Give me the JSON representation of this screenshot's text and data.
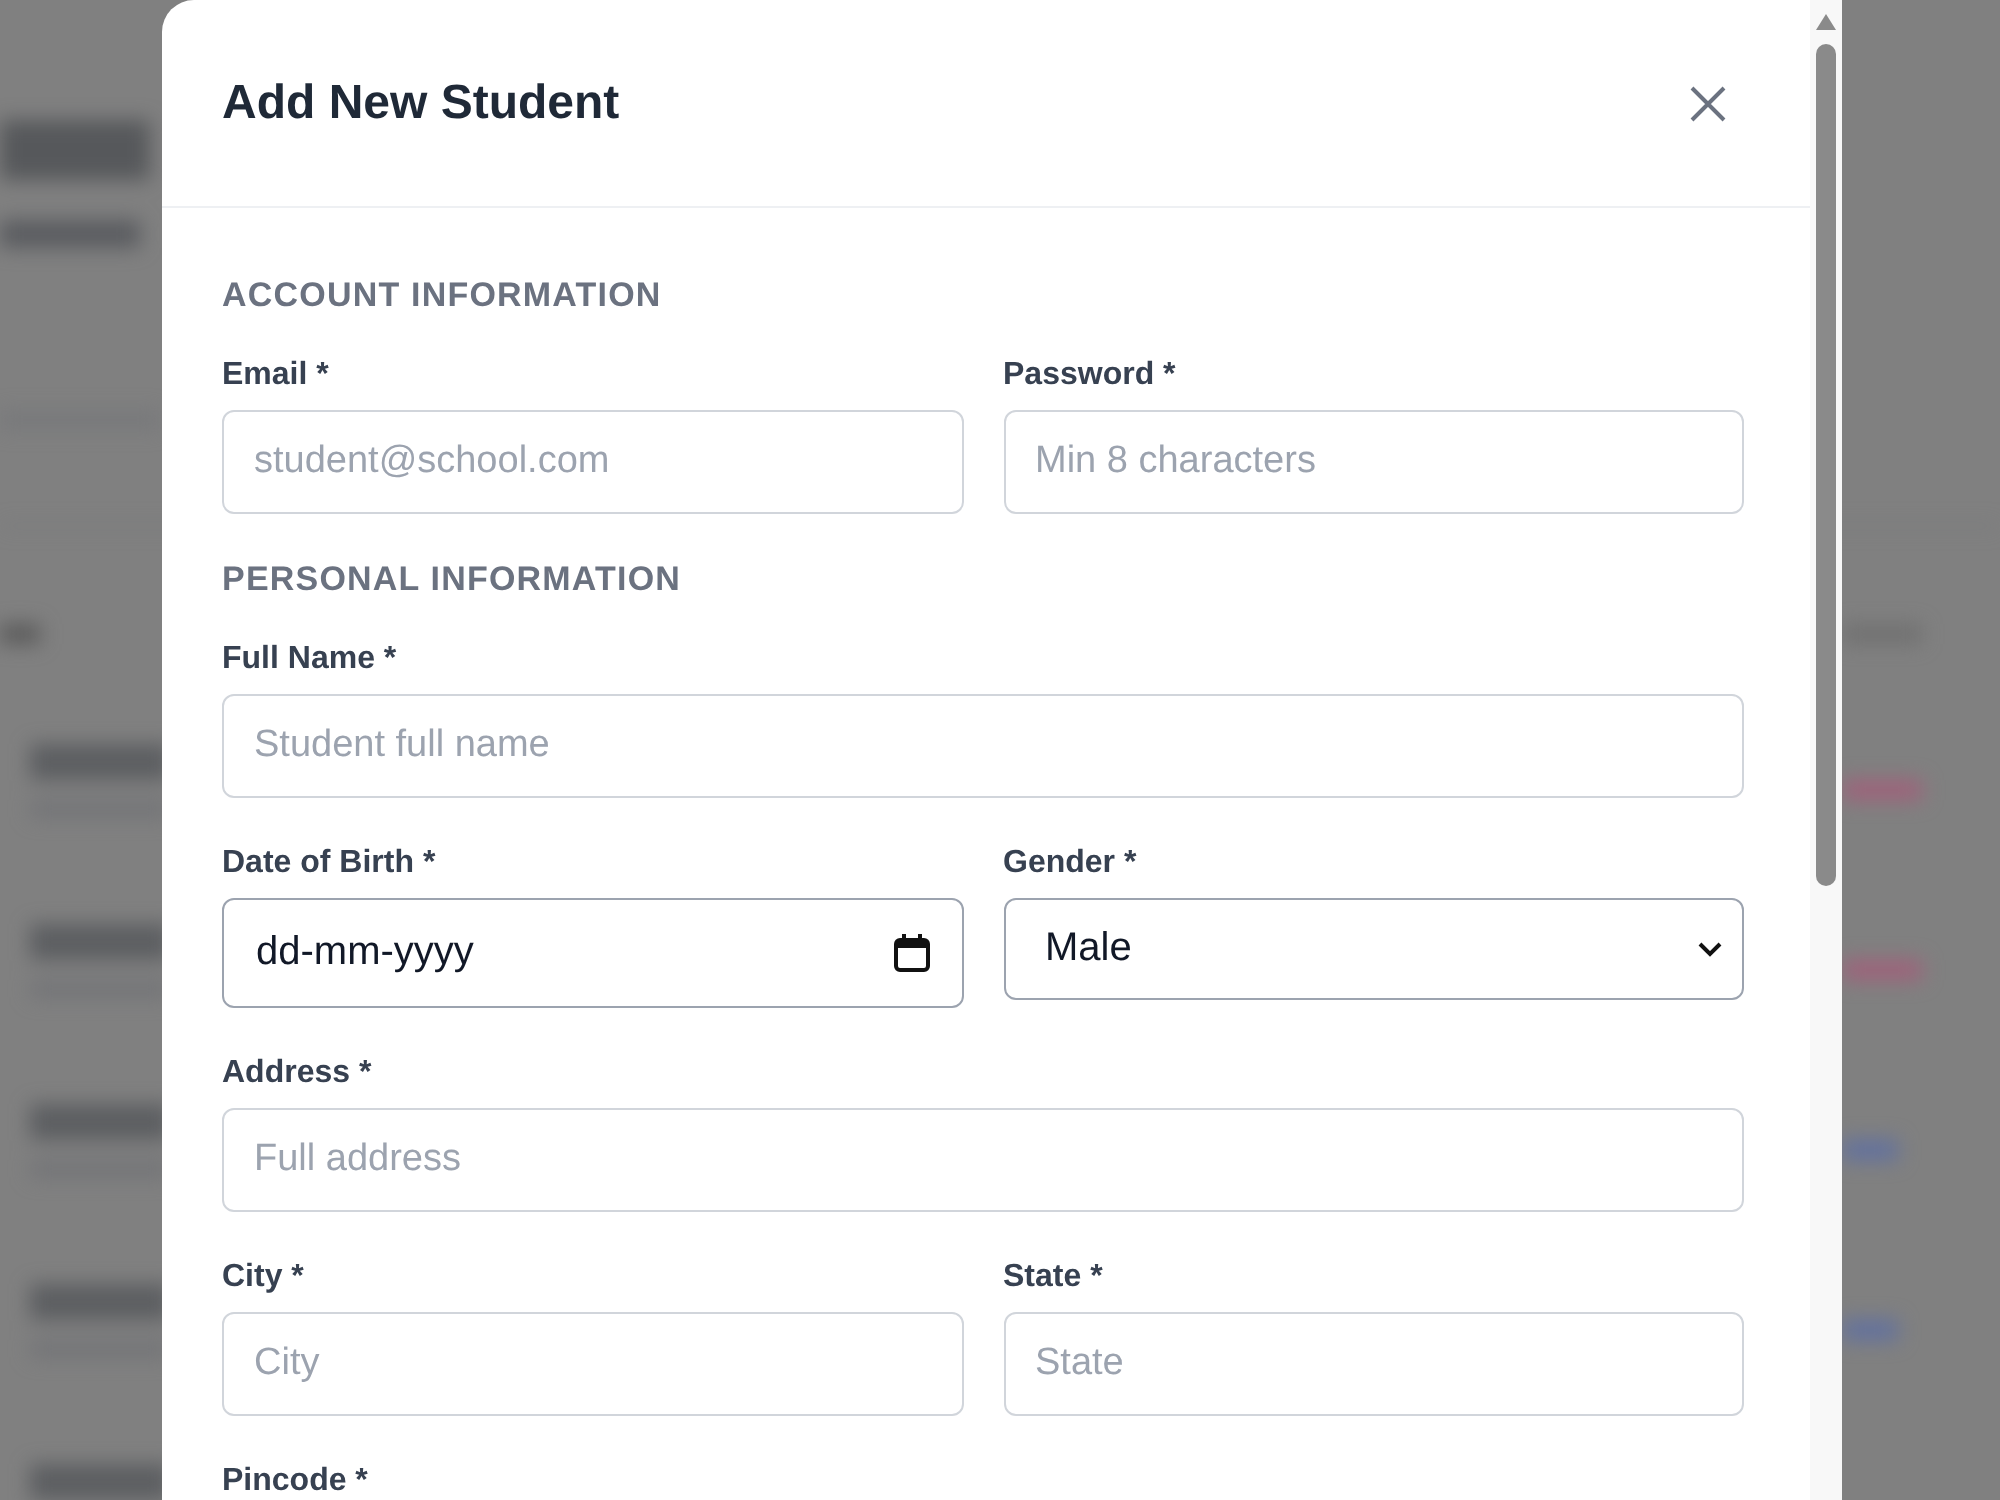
{
  "dialog": {
    "title": "Add New Student",
    "sections": [
      {
        "title": "ACCOUNT INFORMATION",
        "rows": [
          [
            {
              "label": "Email *",
              "kind": "text",
              "placeholder": "student@school.com"
            },
            {
              "label": "Password *",
              "kind": "text",
              "placeholder": "Min 8 characters"
            }
          ]
        ]
      },
      {
        "title": "PERSONAL INFORMATION",
        "rows": [
          [
            {
              "label": "Full Name *",
              "kind": "text",
              "placeholder": "Student full name"
            }
          ],
          [
            {
              "label": "Date of Birth *",
              "kind": "date",
              "value": "dd-mm-yyyy"
            },
            {
              "label": "Gender *",
              "kind": "select",
              "value": "Male"
            }
          ],
          [
            {
              "label": "Address *",
              "kind": "text",
              "placeholder": "Full address"
            }
          ],
          [
            {
              "label": "City *",
              "kind": "text",
              "placeholder": "City"
            },
            {
              "label": "State *",
              "kind": "text",
              "placeholder": "State"
            }
          ],
          [
            {
              "label": "Pincode *"
            }
          ]
        ]
      }
    ]
  }
}
